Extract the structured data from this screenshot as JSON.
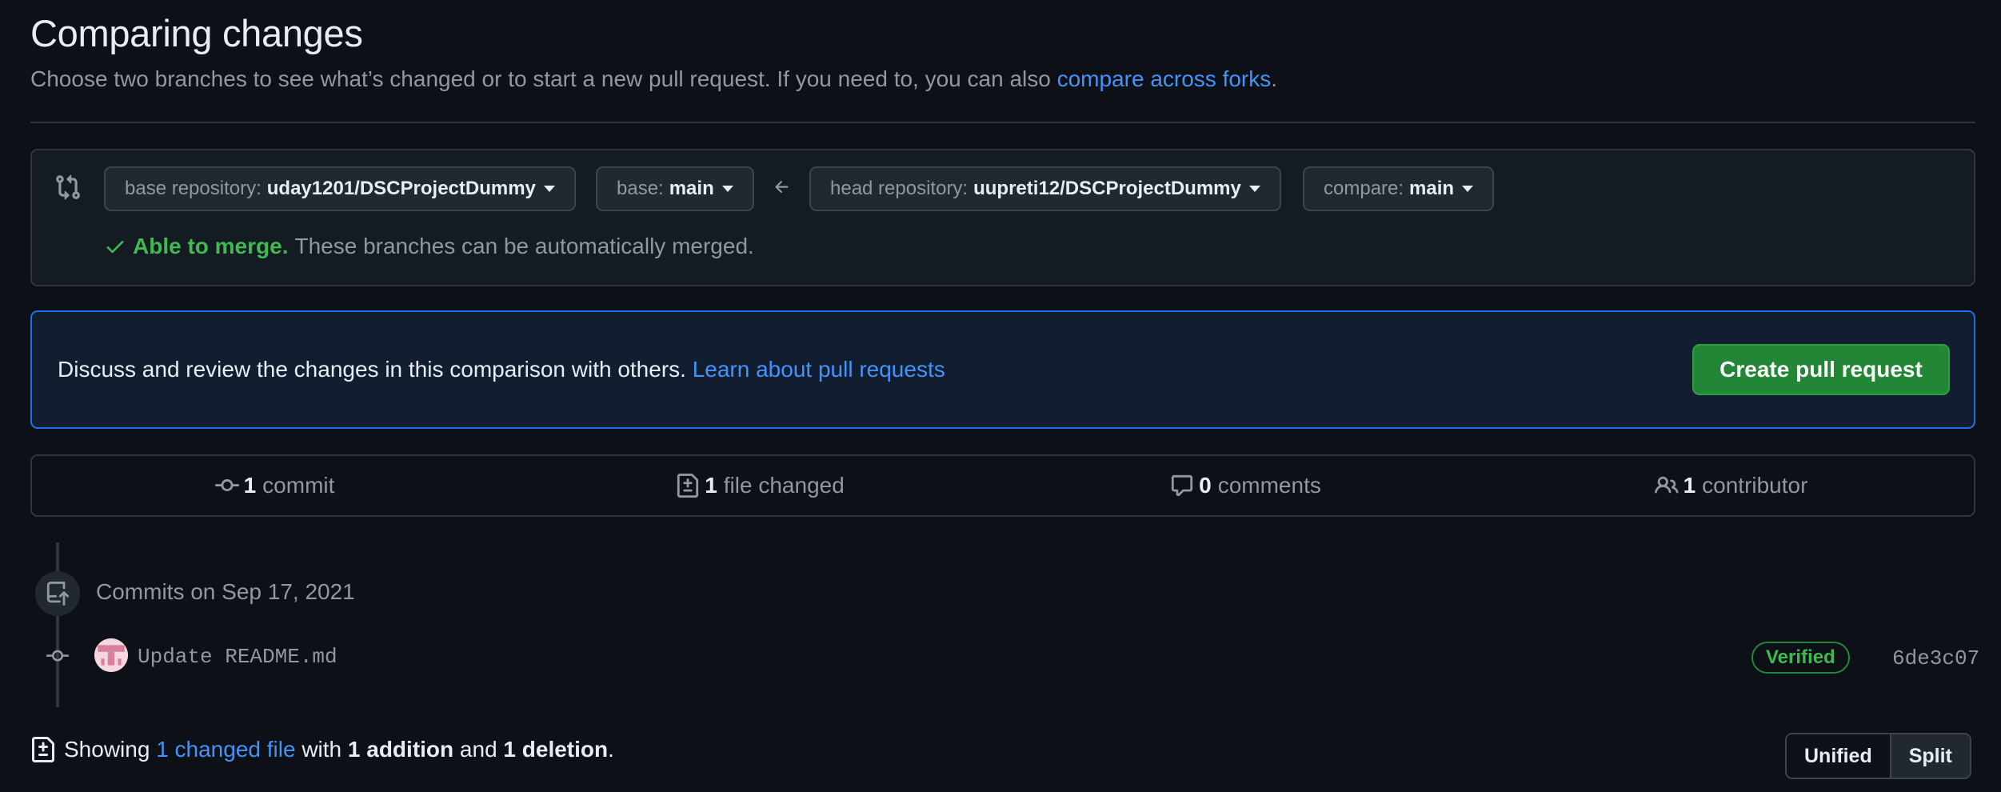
{
  "header": {
    "title": "Comparing changes",
    "subtitle": "Choose two branches to see what’s changed or to start a new pull request. If you need to, you can also ",
    "subtitle_link": "compare across forks",
    "subtitle_end": "."
  },
  "range": {
    "base_repo_label": "base repository:",
    "base_repo_value": "uday1201/DSCProjectDummy",
    "base_label": "base:",
    "base_value": "main",
    "head_repo_label": "head repository:",
    "head_repo_value": "uupreti12/DSCProjectDummy",
    "compare_label": "compare:",
    "compare_value": "main",
    "merge_status": "Able to merge.",
    "merge_detail": "These branches can be automatically merged."
  },
  "blankslate": {
    "text": "Discuss and review the changes in this comparison with others. ",
    "link": "Learn about pull requests",
    "button": "Create pull request"
  },
  "stats": {
    "commits_count": "1",
    "commits_label": "commit",
    "files_count": "1",
    "files_label": "file changed",
    "comments_count": "0",
    "comments_label": "comments",
    "contributors_count": "1",
    "contributors_label": "contributor"
  },
  "commits": {
    "date_heading": "Commits on Sep 17, 2021",
    "items": [
      {
        "message": "Update README.md",
        "badge": "Verified",
        "sha": "6de3c07"
      }
    ]
  },
  "diffstat": {
    "prefix": "Showing ",
    "files_link": "1 changed file",
    "with": " with ",
    "additions": "1 addition",
    "and": " and ",
    "deletions": "1 deletion",
    "end": "."
  },
  "view_toggle": {
    "unified": "Unified",
    "split": "Split"
  },
  "colors": {
    "accent": "#4493f8",
    "success": "#3fb950",
    "button": "#238636",
    "background": "#0d1117"
  }
}
